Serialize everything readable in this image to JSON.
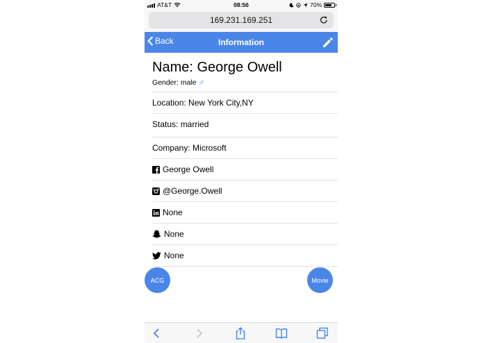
{
  "status_bar": {
    "carrier": "AT&T",
    "time": "08:56",
    "battery": "70%"
  },
  "browser": {
    "url": "169.231.169.251"
  },
  "nav": {
    "back_label": "Back",
    "title": "Information"
  },
  "profile": {
    "name": "Name: George Owell",
    "gender": "Gender: male",
    "location": "Location: New York City,NY",
    "status": "Status: married",
    "company": "Company: Microsoft",
    "facebook": "George Owell",
    "instagram": "@George.Owell",
    "linkedin": "None",
    "snapchat": "None",
    "twitter": "None"
  },
  "buttons": {
    "acg": "ACG",
    "movie": "Movie"
  },
  "icons": [
    "back-chevron-icon",
    "pencil-icon",
    "reload-icon",
    "male-icon",
    "facebook-icon",
    "instagram-icon",
    "linkedin-icon",
    "snapchat-icon",
    "twitter-icon",
    "share-icon",
    "bookmarks-icon",
    "tabs-icon"
  ],
  "colors": {
    "accent": "#4a86e8"
  }
}
